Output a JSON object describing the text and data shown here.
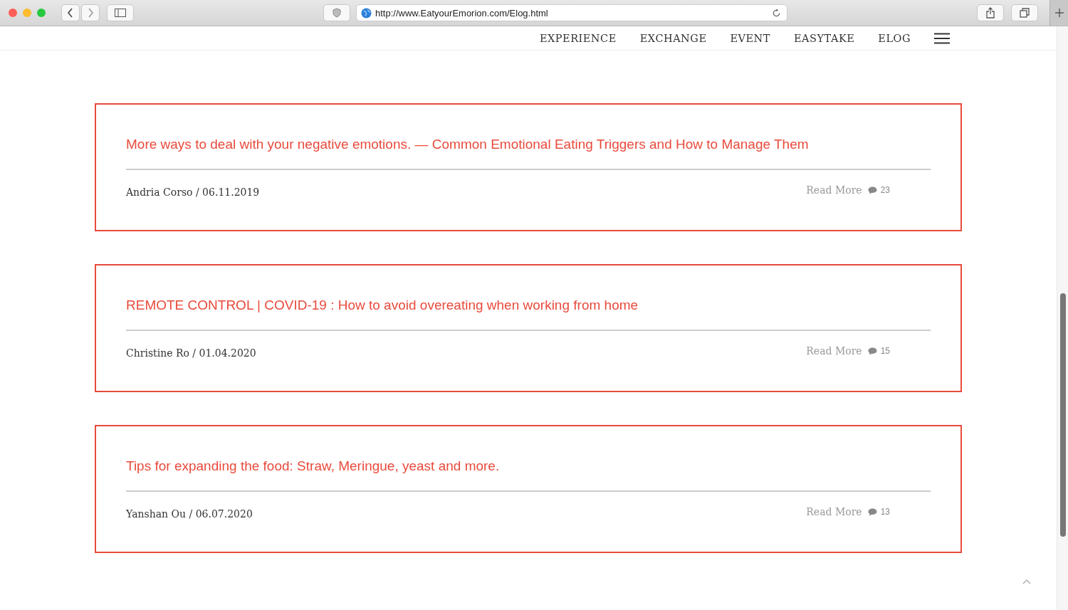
{
  "browser": {
    "url": "http://www.EatyourEmorion.com/Elog.html"
  },
  "nav": {
    "items": [
      {
        "label": "EXPERIENCE"
      },
      {
        "label": "EXCHANGE"
      },
      {
        "label": "EVENT"
      },
      {
        "label": "EASYTAKE"
      },
      {
        "label": "ELOG"
      }
    ]
  },
  "posts": [
    {
      "title": "More ways to deal with your negative emotions. — Common Emotional Eating Triggers and How to Manage Them",
      "byline": "Andria Corso / 06.11.2019",
      "read_more": "Read More",
      "comments": "23"
    },
    {
      "title": "REMOTE CONTROL | COVID-19 : How to avoid overeating when working from home",
      "byline": "Christine Ro / 01.04.2020",
      "read_more": "Read More",
      "comments": "15"
    },
    {
      "title": "Tips for expanding the food: Straw, Meringue, yeast and more.",
      "byline": "Yanshan Ou / 06.07.2020",
      "read_more": "Read More",
      "comments": "13"
    }
  ]
}
